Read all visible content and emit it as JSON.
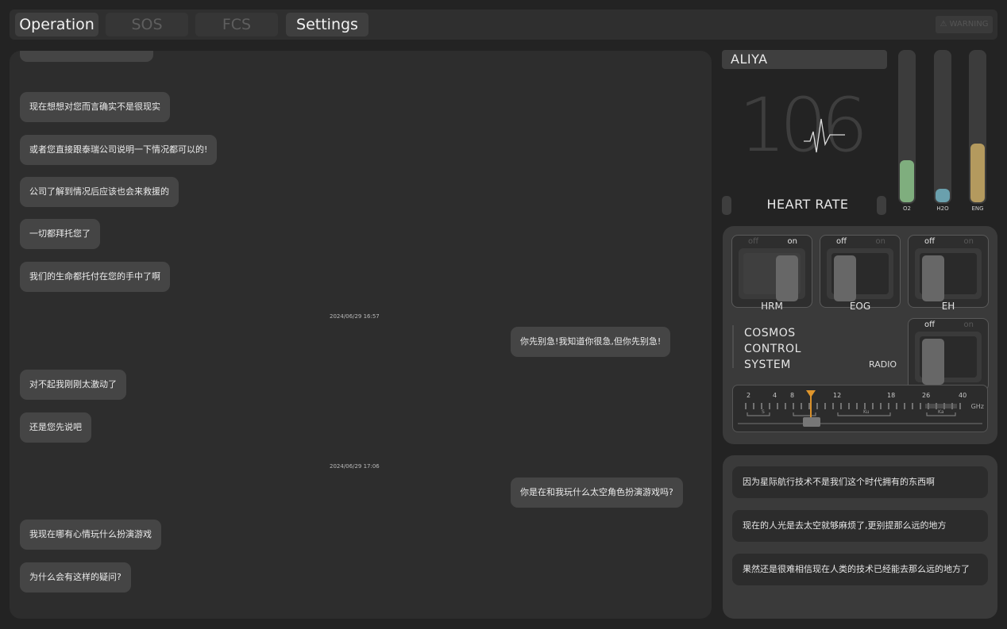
{
  "nav": {
    "tabs": [
      {
        "label": "Operation"
      },
      {
        "label": "SOS"
      },
      {
        "label": "FCS"
      },
      {
        "label": "Settings"
      }
    ],
    "warning_label": "⚠ WARNING"
  },
  "chat": {
    "messages": [
      {
        "side": "left",
        "text": "现在想想对您而言确实不是很现实"
      },
      {
        "side": "left",
        "text": "或者您直接跟泰瑞公司说明一下情况都可以的!"
      },
      {
        "side": "left",
        "text": "公司了解到情况后应该也会来救援的"
      },
      {
        "side": "left",
        "text": "一切都拜托您了"
      },
      {
        "side": "left",
        "text": "我们的生命都托付在您的手中了啊"
      },
      {
        "side": "stamp",
        "text": "2024/06/29 16:57"
      },
      {
        "side": "right",
        "text": "你先别急!我知道你很急,但你先别急!"
      },
      {
        "side": "left",
        "text": "对不起我刚刚太激动了"
      },
      {
        "side": "left",
        "text": "还是您先说吧"
      },
      {
        "side": "stamp",
        "text": "2024/06/29 17:06"
      },
      {
        "side": "right",
        "text": "你是在和我玩什么太空角色扮演游戏吗?"
      },
      {
        "side": "left",
        "text": "我现在哪有心情玩什么扮演游戏"
      },
      {
        "side": "left",
        "text": "为什么会有这样的疑问?"
      }
    ]
  },
  "vitals": {
    "name": "ALIYA",
    "heart_rate": "106",
    "heart_rate_label": "HEART RATE",
    "gauges": [
      {
        "label": "O2",
        "level": 0.28,
        "color": "#7fae7e"
      },
      {
        "label": "H2O",
        "level": 0.09,
        "color": "#6aa0ad"
      },
      {
        "label": "ENG",
        "level": 0.39,
        "color": "#b49a5e"
      }
    ]
  },
  "controls": {
    "switches": [
      {
        "name": "HRM",
        "off": "off",
        "on": "on",
        "state": "on"
      },
      {
        "name": "EOG",
        "off": "off",
        "on": "on",
        "state": "off"
      },
      {
        "name": "EH",
        "off": "off",
        "on": "on",
        "state": "off"
      }
    ],
    "system_lines": [
      "COSMOS",
      "CONTROL",
      "SYSTEM"
    ],
    "radio": {
      "label": "RADIO",
      "off": "off",
      "on": "on",
      "state": "off"
    },
    "tuner": {
      "ticks": [
        "2",
        "4",
        "8",
        "12",
        "18",
        "26",
        "40"
      ],
      "unit": "GHz",
      "bands": [
        "S",
        "Ku",
        "Ka"
      ]
    }
  },
  "feed": {
    "items": [
      "因为星际航行技术不是我们这个时代拥有的东西啊",
      "现在的人光是去太空就够麻烦了,更别提那么远的地方",
      "果然还是很难相信现在人类的技术已经能去那么远的地方了"
    ]
  }
}
